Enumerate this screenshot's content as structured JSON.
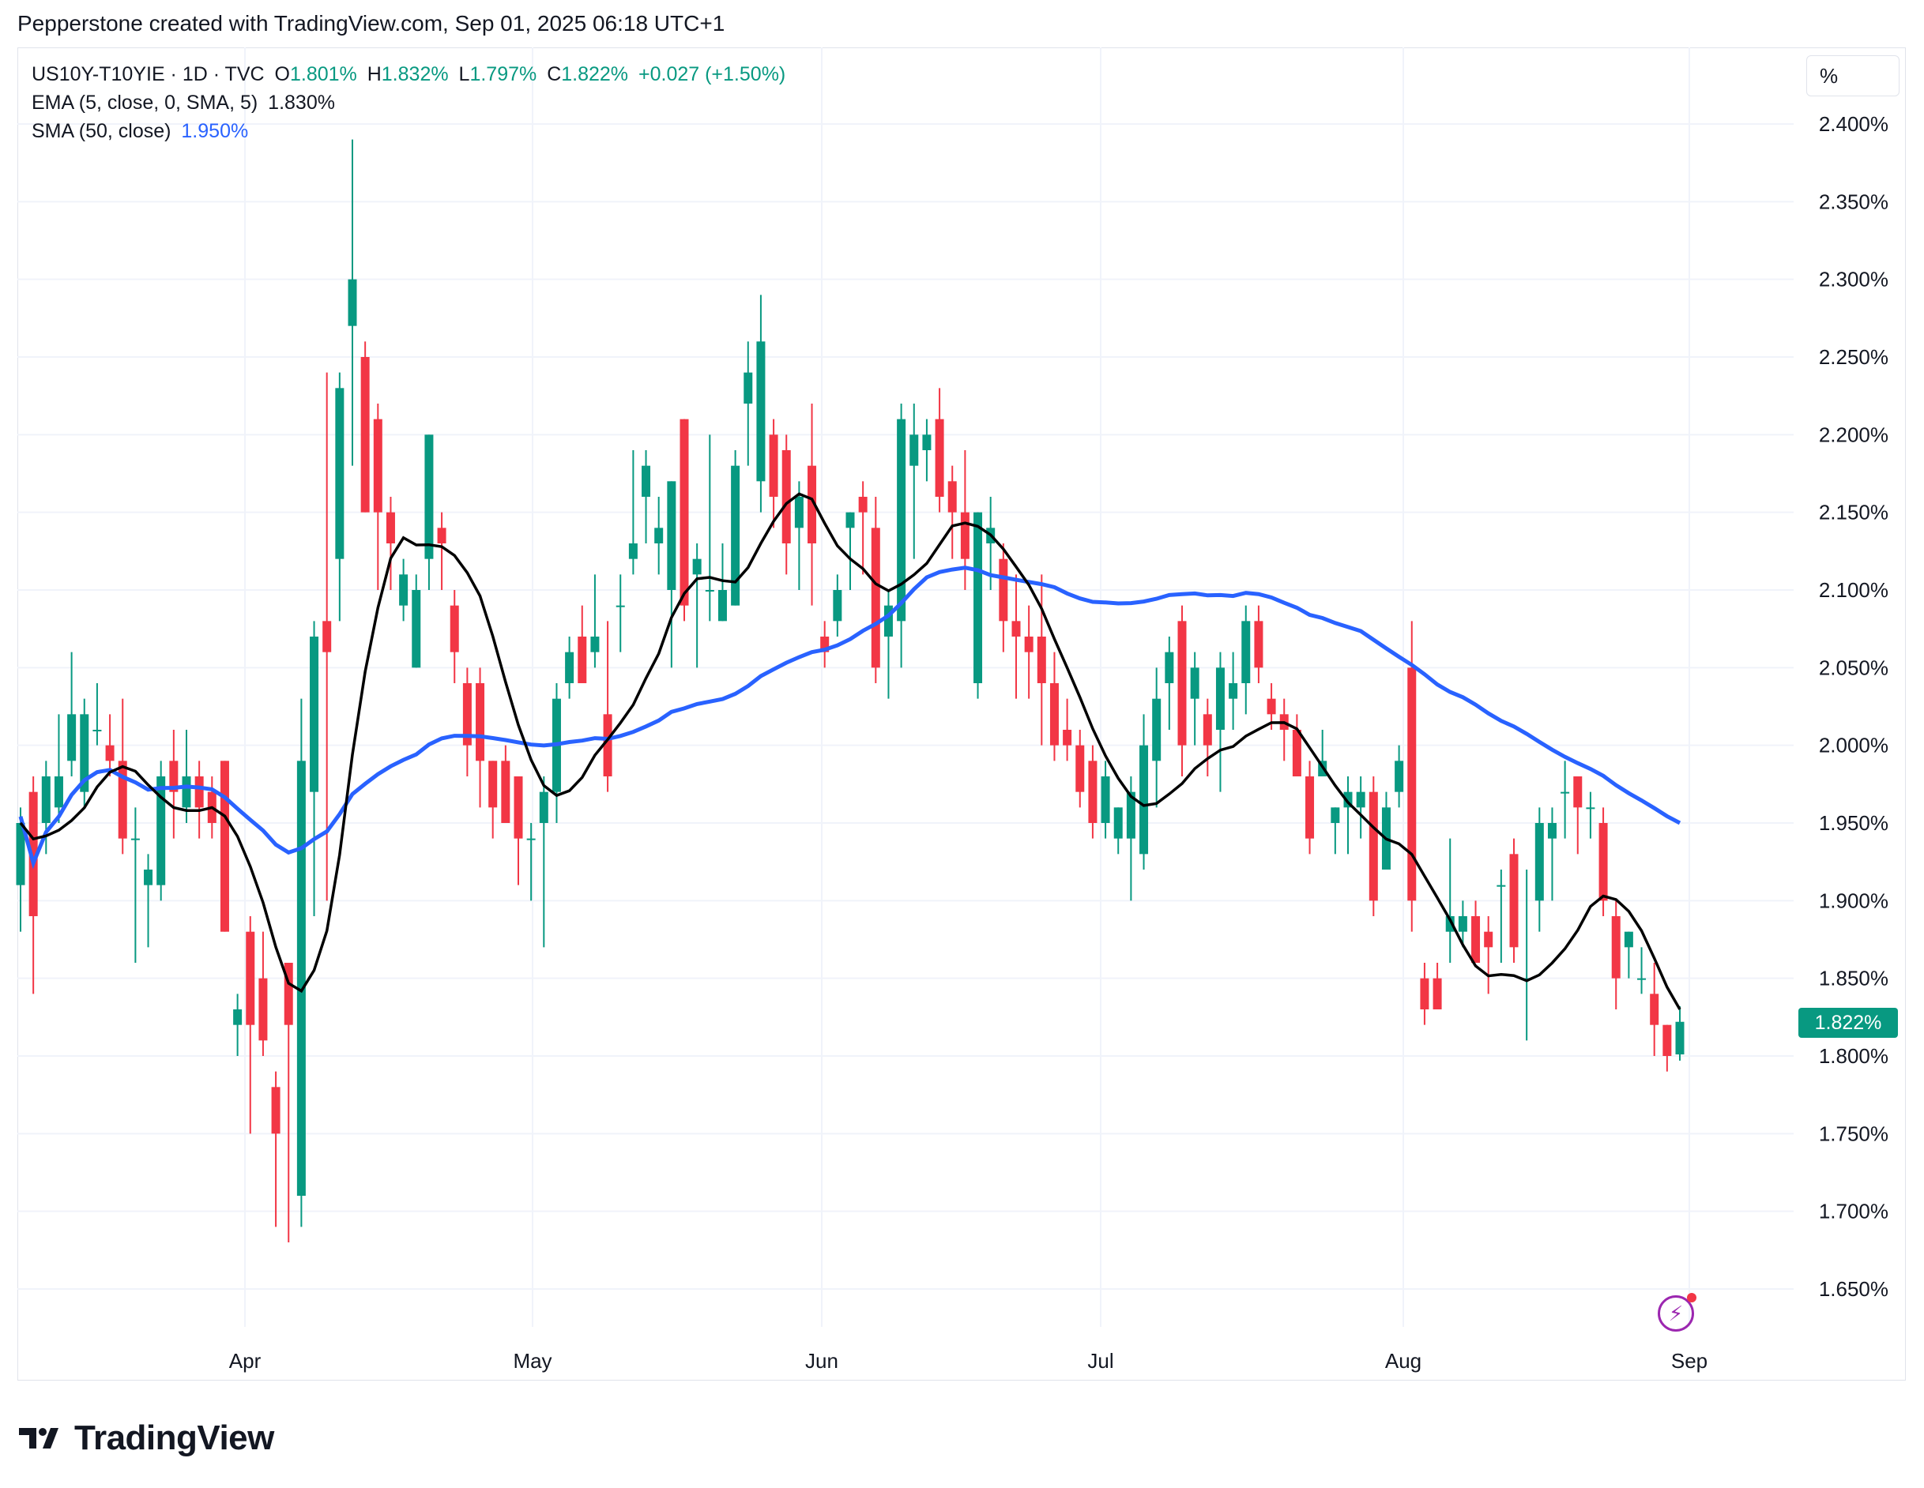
{
  "header": {
    "caption": "Pepperstone created with TradingView.com, Sep 01, 2025 06:18 UTC+1"
  },
  "legend": {
    "symbol": "US10Y-T10YIE · 1D · TVC",
    "o_label": "O",
    "o_value": "1.801%",
    "h_label": "H",
    "h_value": "1.832%",
    "l_label": "L",
    "l_value": "1.797%",
    "c_label": "C",
    "c_value": "1.822%",
    "change": "+0.027 (+1.50%)",
    "ema_label": "EMA (5, close, 0, SMA, 5)",
    "ema_value": "1.830%",
    "sma_label": "SMA (50, close)",
    "sma_value": "1.950%"
  },
  "unit_button": "%",
  "last_price_tag": "1.822%",
  "logo_text": "TradingView",
  "icons": [
    "tradingview-logo-icon",
    "flash-icon"
  ],
  "colors": {
    "up": "#089981",
    "down": "#f23645",
    "ema": "#000000",
    "sma": "#2962ff",
    "grid": "#f0f3fa"
  },
  "chart_data": {
    "type": "candlestick",
    "y_ticks": [
      "2.400%",
      "2.350%",
      "2.300%",
      "2.250%",
      "2.200%",
      "2.150%",
      "2.100%",
      "2.050%",
      "2.000%",
      "1.950%",
      "1.900%",
      "1.850%",
      "1.800%",
      "1.750%",
      "1.700%",
      "1.650%"
    ],
    "ylim": [
      1.62,
      2.42
    ],
    "x_ticks": [
      "Apr",
      "May",
      "Jun",
      "Jul",
      "Aug",
      "Sep"
    ],
    "grid": true,
    "candles": [
      [
        1.91,
        1.95,
        1.88,
        1.96
      ],
      [
        1.97,
        1.89,
        1.84,
        1.98
      ],
      [
        1.95,
        1.98,
        1.93,
        1.99
      ],
      [
        1.96,
        1.98,
        1.95,
        2.02
      ],
      [
        1.99,
        2.02,
        1.98,
        2.06
      ],
      [
        1.97,
        2.02,
        1.96,
        2.03
      ],
      [
        2.01,
        2.01,
        2.0,
        2.04
      ],
      [
        2.0,
        1.99,
        1.98,
        2.02
      ],
      [
        1.99,
        1.94,
        1.93,
        2.03
      ],
      [
        1.94,
        1.94,
        1.86,
        1.96
      ],
      [
        1.91,
        1.92,
        1.87,
        1.93
      ],
      [
        1.91,
        1.98,
        1.9,
        1.99
      ],
      [
        1.99,
        1.97,
        1.94,
        2.01
      ],
      [
        1.96,
        1.98,
        1.95,
        2.01
      ],
      [
        1.98,
        1.96,
        1.94,
        1.99
      ],
      [
        1.97,
        1.95,
        1.94,
        1.98
      ],
      [
        1.99,
        1.88,
        1.88,
        1.99
      ],
      [
        1.82,
        1.83,
        1.8,
        1.84
      ],
      [
        1.88,
        1.82,
        1.75,
        1.89
      ],
      [
        1.85,
        1.81,
        1.8,
        1.88
      ],
      [
        1.78,
        1.75,
        1.69,
        1.79
      ],
      [
        1.86,
        1.82,
        1.68,
        1.86
      ],
      [
        1.71,
        1.99,
        1.69,
        2.03
      ],
      [
        1.97,
        2.07,
        1.89,
        2.08
      ],
      [
        2.08,
        2.06,
        1.9,
        2.24
      ],
      [
        2.12,
        2.23,
        2.08,
        2.24
      ],
      [
        2.27,
        2.3,
        2.18,
        2.39
      ],
      [
        2.25,
        2.15,
        2.19,
        2.26
      ],
      [
        2.21,
        2.15,
        2.1,
        2.22
      ],
      [
        2.15,
        2.13,
        2.1,
        2.16
      ],
      [
        2.09,
        2.11,
        2.08,
        2.12
      ],
      [
        2.05,
        2.1,
        2.05,
        2.11
      ],
      [
        2.12,
        2.2,
        2.1,
        2.2
      ],
      [
        2.14,
        2.13,
        2.1,
        2.15
      ],
      [
        2.09,
        2.06,
        2.04,
        2.1
      ],
      [
        2.04,
        2.0,
        1.98,
        2.05
      ],
      [
        2.04,
        1.99,
        1.96,
        2.05
      ],
      [
        1.99,
        1.96,
        1.94,
        1.99
      ],
      [
        1.99,
        1.95,
        1.95,
        2.0
      ],
      [
        1.98,
        1.94,
        1.91,
        1.98
      ],
      [
        1.94,
        1.94,
        1.9,
        1.95
      ],
      [
        1.95,
        1.97,
        1.87,
        1.98
      ],
      [
        1.97,
        2.03,
        1.95,
        2.04
      ],
      [
        2.04,
        2.06,
        2.03,
        2.07
      ],
      [
        2.07,
        2.04,
        2.05,
        2.09
      ],
      [
        2.06,
        2.07,
        2.05,
        2.11
      ],
      [
        2.02,
        1.98,
        1.97,
        2.08
      ],
      [
        2.09,
        2.09,
        2.06,
        2.11
      ],
      [
        2.12,
        2.13,
        2.11,
        2.19
      ],
      [
        2.16,
        2.18,
        2.13,
        2.19
      ],
      [
        2.13,
        2.14,
        2.11,
        2.16
      ],
      [
        2.1,
        2.17,
        2.05,
        2.17
      ],
      [
        2.21,
        2.09,
        2.08,
        2.21
      ],
      [
        2.11,
        2.12,
        2.05,
        2.13
      ],
      [
        2.1,
        2.1,
        2.08,
        2.2
      ],
      [
        2.08,
        2.1,
        2.09,
        2.13
      ],
      [
        2.09,
        2.18,
        2.13,
        2.19
      ],
      [
        2.22,
        2.24,
        2.18,
        2.26
      ],
      [
        2.17,
        2.26,
        2.15,
        2.29
      ],
      [
        2.2,
        2.16,
        2.14,
        2.21
      ],
      [
        2.19,
        2.13,
        2.11,
        2.2
      ],
      [
        2.14,
        2.16,
        2.1,
        2.17
      ],
      [
        2.18,
        2.13,
        2.09,
        2.22
      ],
      [
        2.07,
        2.06,
        2.05,
        2.08
      ],
      [
        2.08,
        2.1,
        2.07,
        2.11
      ],
      [
        2.14,
        2.15,
        2.1,
        2.15
      ],
      [
        2.16,
        2.15,
        2.11,
        2.17
      ],
      [
        2.14,
        2.05,
        2.04,
        2.16
      ],
      [
        2.07,
        2.09,
        2.03,
        2.1
      ],
      [
        2.08,
        2.21,
        2.05,
        2.22
      ],
      [
        2.18,
        2.2,
        2.12,
        2.22
      ],
      [
        2.19,
        2.2,
        2.17,
        2.21
      ],
      [
        2.21,
        2.16,
        2.15,
        2.23
      ],
      [
        2.17,
        2.15,
        2.12,
        2.18
      ],
      [
        2.15,
        2.12,
        2.1,
        2.19
      ],
      [
        2.04,
        2.15,
        2.03,
        2.15
      ],
      [
        2.13,
        2.14,
        2.1,
        2.16
      ],
      [
        2.12,
        2.08,
        2.06,
        2.13
      ],
      [
        2.08,
        2.07,
        2.03,
        2.11
      ],
      [
        2.07,
        2.06,
        2.03,
        2.09
      ],
      [
        2.07,
        2.04,
        2.0,
        2.11
      ],
      [
        2.04,
        2.0,
        1.99,
        2.06
      ],
      [
        2.01,
        2.0,
        1.99,
        2.03
      ],
      [
        2.0,
        1.97,
        1.96,
        2.01
      ],
      [
        1.99,
        1.95,
        1.94,
        2.0
      ],
      [
        1.95,
        1.98,
        1.94,
        1.99
      ],
      [
        1.94,
        1.96,
        1.93,
        1.96
      ],
      [
        1.94,
        1.97,
        1.9,
        1.98
      ],
      [
        1.93,
        2.0,
        1.92,
        2.02
      ],
      [
        1.99,
        2.03,
        1.96,
        2.05
      ],
      [
        2.04,
        2.06,
        2.01,
        2.07
      ],
      [
        2.08,
        2.0,
        1.98,
        2.09
      ],
      [
        2.03,
        2.05,
        2.0,
        2.06
      ],
      [
        2.02,
        2.0,
        1.98,
        2.03
      ],
      [
        2.01,
        2.05,
        1.97,
        2.06
      ],
      [
        2.03,
        2.04,
        2.01,
        2.06
      ],
      [
        2.04,
        2.08,
        2.02,
        2.09
      ],
      [
        2.08,
        2.05,
        2.04,
        2.09
      ],
      [
        2.03,
        2.02,
        2.01,
        2.04
      ],
      [
        2.02,
        2.01,
        1.99,
        2.03
      ],
      [
        2.01,
        1.98,
        1.98,
        2.02
      ],
      [
        1.98,
        1.94,
        1.93,
        1.99
      ],
      [
        1.98,
        1.99,
        1.98,
        2.01
      ],
      [
        1.95,
        1.96,
        1.93,
        1.96
      ],
      [
        1.96,
        1.97,
        1.93,
        1.98
      ],
      [
        1.96,
        1.97,
        1.94,
        1.98
      ],
      [
        1.97,
        1.9,
        1.89,
        1.98
      ],
      [
        1.92,
        1.96,
        1.92,
        1.97
      ],
      [
        1.97,
        1.99,
        1.96,
        2.0
      ],
      [
        2.05,
        1.9,
        1.88,
        2.08
      ],
      [
        1.85,
        1.83,
        1.82,
        1.86
      ],
      [
        1.85,
        1.83,
        1.83,
        1.86
      ],
      [
        1.88,
        1.89,
        1.86,
        1.94
      ],
      [
        1.88,
        1.89,
        1.87,
        1.9
      ],
      [
        1.89,
        1.86,
        1.86,
        1.9
      ],
      [
        1.88,
        1.87,
        1.84,
        1.89
      ],
      [
        1.91,
        1.91,
        1.86,
        1.92
      ],
      [
        1.93,
        1.87,
        1.86,
        1.94
      ],
      [
        1.85,
        1.85,
        1.81,
        1.92
      ],
      [
        1.9,
        1.95,
        1.88,
        1.96
      ],
      [
        1.94,
        1.95,
        1.9,
        1.96
      ],
      [
        1.97,
        1.97,
        1.94,
        1.99
      ],
      [
        1.98,
        1.96,
        1.93,
        1.98
      ],
      [
        1.96,
        1.96,
        1.94,
        1.97
      ],
      [
        1.95,
        1.9,
        1.89,
        1.96
      ],
      [
        1.89,
        1.85,
        1.83,
        1.9
      ],
      [
        1.87,
        1.88,
        1.85,
        1.88
      ],
      [
        1.85,
        1.85,
        1.84,
        1.87
      ],
      [
        1.84,
        1.82,
        1.8,
        1.86
      ],
      [
        1.82,
        1.8,
        1.79,
        1.82
      ],
      [
        1.801,
        1.822,
        1.797,
        1.832
      ]
    ],
    "ema_last": 1.83,
    "sma_last": 1.95
  }
}
